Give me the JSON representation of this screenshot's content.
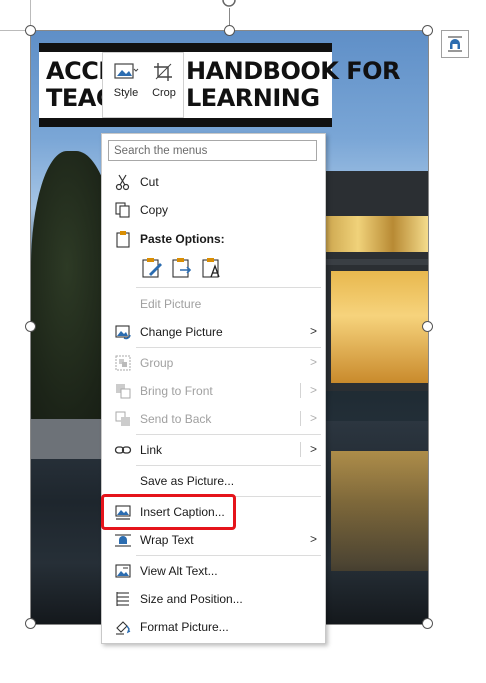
{
  "banner": {
    "line1_left": "ACCES",
    "line1_right": "HANDBOOK FOR",
    "line2_left": "TEACH",
    "line2_right": "LEARNING"
  },
  "mini_toolbar": {
    "style_label": "Style",
    "crop_label": "Crop"
  },
  "menu": {
    "search_placeholder": "Search the menus",
    "cut": "Cut",
    "copy": "Copy",
    "paste_options": "Paste Options:",
    "edit_picture": "Edit Picture",
    "change_picture": "Change Picture",
    "group": "Group",
    "bring_to_front": "Bring to Front",
    "send_to_back": "Send to Back",
    "link": "Link",
    "save_as_picture": "Save as Picture...",
    "insert_caption": "Insert Caption...",
    "wrap_text": "Wrap Text",
    "view_alt_text": "View Alt Text...",
    "size_and_position": "Size and Position...",
    "format_picture": "Format Picture...",
    "submenu_arrow": ">"
  },
  "colors": {
    "highlight": "#e5141b",
    "icon_blue": "#2b6cb0",
    "icon_orange": "#d98e04"
  },
  "icons": [
    "scissors-icon",
    "copy-icon",
    "paste-icon",
    "paste-picture-icon",
    "paste-link-icon",
    "paste-text-icon",
    "change-picture-icon",
    "group-icon",
    "bring-front-icon",
    "send-back-icon",
    "link-icon",
    "insert-caption-icon",
    "wrap-text-icon",
    "alt-text-icon",
    "size-position-icon",
    "format-picture-icon",
    "layout-options-icon",
    "rotate-handle-icon"
  ]
}
